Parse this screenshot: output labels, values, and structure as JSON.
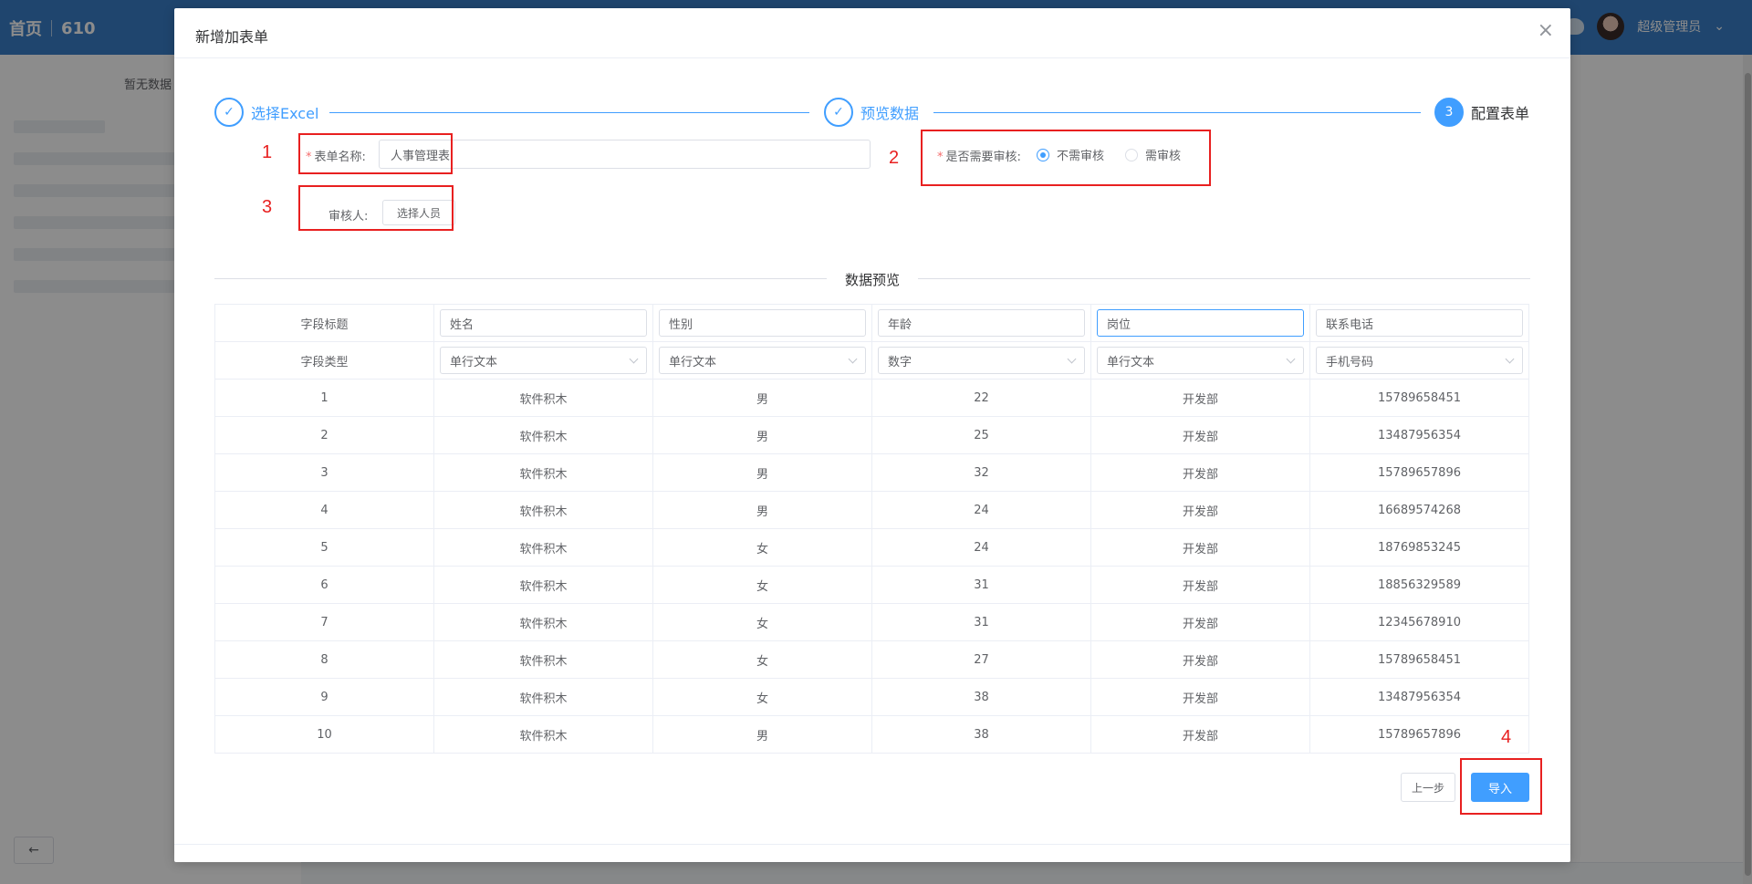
{
  "app": {
    "home": "首页",
    "project": "610",
    "user": "超级管理员",
    "no_data": "暂无数据"
  },
  "dialog": {
    "title": "新增加表单",
    "close": "×"
  },
  "steps": [
    {
      "label": "选择Excel",
      "status": "done",
      "icon": "check-icon"
    },
    {
      "label": "预览数据",
      "status": "done",
      "icon": "check-icon"
    },
    {
      "label": "配置表单",
      "status": "active",
      "number": "3"
    }
  ],
  "form": {
    "name_label": "表单名称:",
    "name_value": "人事管理表.",
    "audit_label": "是否需要审核:",
    "audit_options": [
      "不需审核",
      "需审核"
    ],
    "audit_selected": "不需审核",
    "reviewer_label": "审核人:",
    "reviewer_button": "选择人员"
  },
  "annotations": [
    "1",
    "2",
    "3",
    "4"
  ],
  "preview": {
    "title": "数据预览",
    "title_row_label": "字段标题",
    "type_row_label": "字段类型",
    "field_titles": [
      "姓名",
      "性别",
      "年龄",
      "岗位",
      "联系电话"
    ],
    "field_types": [
      "单行文本",
      "单行文本",
      "数字",
      "单行文本",
      "手机号码"
    ],
    "rows": [
      [
        "1",
        "软件积木",
        "男",
        "22",
        "开发部",
        "15789658451"
      ],
      [
        "2",
        "软件积木",
        "男",
        "25",
        "开发部",
        "13487956354"
      ],
      [
        "3",
        "软件积木",
        "男",
        "32",
        "开发部",
        "15789657896"
      ],
      [
        "4",
        "软件积木",
        "男",
        "24",
        "开发部",
        "16689574268"
      ],
      [
        "5",
        "软件积木",
        "女",
        "24",
        "开发部",
        "18769853245"
      ],
      [
        "6",
        "软件积木",
        "女",
        "31",
        "开发部",
        "18856329589"
      ],
      [
        "7",
        "软件积木",
        "女",
        "31",
        "开发部",
        "12345678910"
      ],
      [
        "8",
        "软件积木",
        "女",
        "27",
        "开发部",
        "15789658451"
      ],
      [
        "9",
        "软件积木",
        "女",
        "38",
        "开发部",
        "13487956354"
      ],
      [
        "10",
        "软件积木",
        "男",
        "38",
        "开发部",
        "15789657896"
      ]
    ]
  },
  "footer": {
    "prev": "上一步",
    "import": "导入"
  },
  "colors": {
    "primary": "#409eff",
    "header": "#3a7fc8",
    "annotation": "#e82020"
  }
}
